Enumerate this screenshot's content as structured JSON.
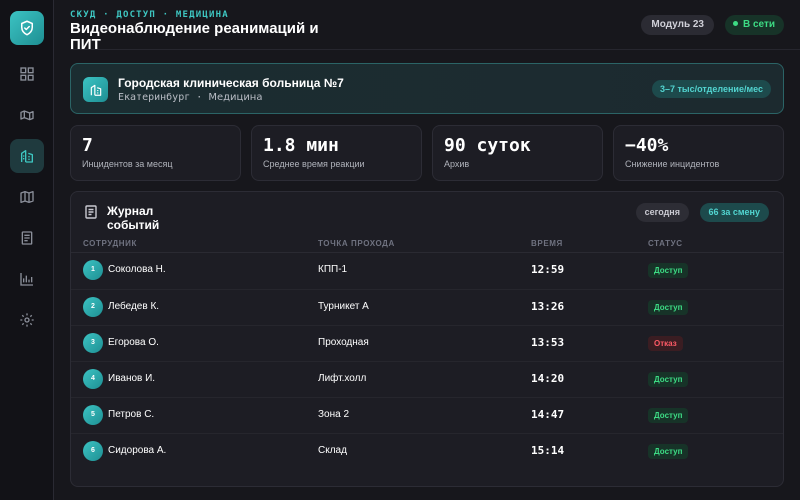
{
  "sidebar": {
    "logo_icon": "shield-check-icon",
    "items": [
      {
        "icon": "dashboard-icon",
        "active": false
      },
      {
        "icon": "camera-icon",
        "active": false
      },
      {
        "icon": "building-icon",
        "active": true
      },
      {
        "icon": "map-icon",
        "active": false
      },
      {
        "icon": "document-icon",
        "active": false
      },
      {
        "icon": "chart-icon",
        "active": false
      },
      {
        "icon": "gear-icon",
        "active": false
      }
    ]
  },
  "header": {
    "breadcrumb": "СКУД · ДОСТУП · МЕДИЦИНА",
    "title": "Видеонаблюдение реанимаций и ПИТ",
    "module_label": "Модуль 23",
    "status_label": "В сети"
  },
  "org": {
    "name": "Городская клиническая больница №7",
    "city": "Екатеринбург",
    "separator": " · ",
    "sector": "Медицина",
    "volume": "3–7 тыс/отделение/мес"
  },
  "stats": [
    {
      "value": "7",
      "label": "Инцидентов за месяц"
    },
    {
      "value": "1.8 мин",
      "label": "Среднее время реакции"
    },
    {
      "value": "90 суток",
      "label": "Архив"
    },
    {
      "value": "−40%",
      "label": "Снижение инцидентов"
    }
  ],
  "journal": {
    "title": "Журнал событий",
    "filter_today": "сегодня",
    "shift_count": "66 за смену",
    "columns": {
      "employee": "СОТРУДНИК",
      "point": "ТОЧКА ПРОХОДА",
      "time": "ВРЕМЯ",
      "status": "СТАТУС"
    },
    "rows": [
      {
        "num": "1",
        "name": "Соколова Н.",
        "point": "КПП-1",
        "time": "12:59",
        "status": "Доступ",
        "kind": "ok"
      },
      {
        "num": "2",
        "name": "Лебедев К.",
        "point": "Турникет А",
        "time": "13:26",
        "status": "Доступ",
        "kind": "ok"
      },
      {
        "num": "3",
        "name": "Егорова О.",
        "point": "Проходная",
        "time": "13:53",
        "status": "Отказ",
        "kind": "deny"
      },
      {
        "num": "4",
        "name": "Иванов И.",
        "point": "Лифт.холл",
        "time": "14:20",
        "status": "Доступ",
        "kind": "ok"
      },
      {
        "num": "5",
        "name": "Петров С.",
        "point": "Зона 2",
        "time": "14:47",
        "status": "Доступ",
        "kind": "ok"
      },
      {
        "num": "6",
        "name": "Сидорова А.",
        "point": "Склад",
        "time": "15:14",
        "status": "Доступ",
        "kind": "ok"
      }
    ]
  },
  "colors": {
    "accent": "#3ec7c2",
    "ok": "#3ddc84",
    "deny": "#ff5a66",
    "background": "#17171c"
  }
}
